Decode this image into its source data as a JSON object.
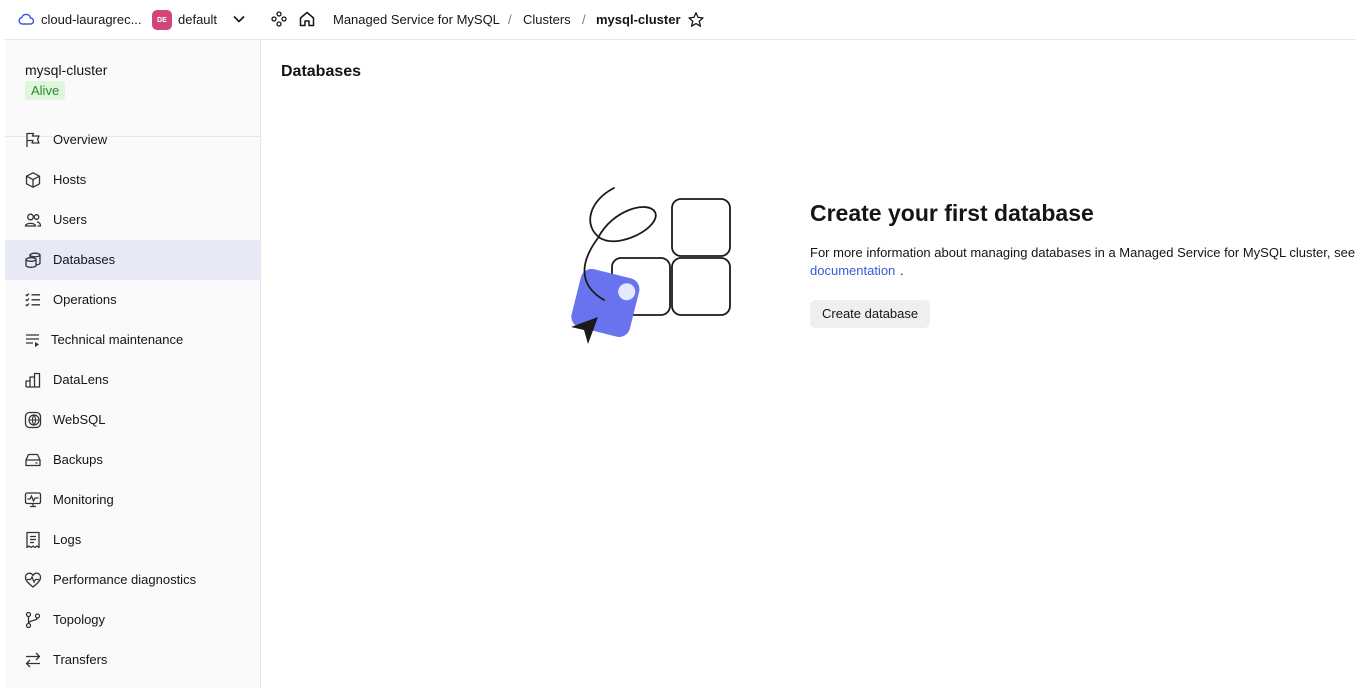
{
  "topbar": {
    "cloud_name": "cloud-lauragrec...",
    "folder_badge": "DE",
    "folder_name": "default",
    "breadcrumbs": [
      "Managed Service for MySQL",
      "Clusters",
      "mysql-cluster"
    ],
    "separator": "/"
  },
  "sidebar": {
    "cluster_name": "mysql-cluster",
    "status": "Alive",
    "items": [
      {
        "label": "Overview",
        "icon": "flag-icon"
      },
      {
        "label": "Hosts",
        "icon": "cube-icon"
      },
      {
        "label": "Users",
        "icon": "users-icon"
      },
      {
        "label": "Databases",
        "icon": "database-icon",
        "active": true
      },
      {
        "label": "Operations",
        "icon": "list-check-icon"
      },
      {
        "label": "Technical maintenance",
        "icon": "list-play-icon"
      },
      {
        "label": "DataLens",
        "icon": "chart-icon"
      },
      {
        "label": "WebSQL",
        "icon": "globe-icon"
      },
      {
        "label": "Backups",
        "icon": "drive-icon"
      },
      {
        "label": "Monitoring",
        "icon": "monitor-icon"
      },
      {
        "label": "Logs",
        "icon": "receipt-icon"
      },
      {
        "label": "Performance diagnostics",
        "icon": "heart-pulse-icon"
      },
      {
        "label": "Topology",
        "icon": "branch-icon"
      },
      {
        "label": "Transfers",
        "icon": "arrows-icon"
      }
    ]
  },
  "main": {
    "title": "Databases",
    "empty_title": "Create your first database",
    "empty_desc": "For more information about managing databases in a Managed Service for MySQL cluster, see the",
    "doc_link": "documentation",
    "doc_dot": ".",
    "create_button": "Create database"
  },
  "colors": {
    "accent": "#3a5bd9",
    "active_bg": "#e7e9f7",
    "status_bg": "#dff5dc",
    "status_text": "#2f8a2a",
    "folder_badge": "#d1457a",
    "illustration_accent": "#6a73ee"
  }
}
